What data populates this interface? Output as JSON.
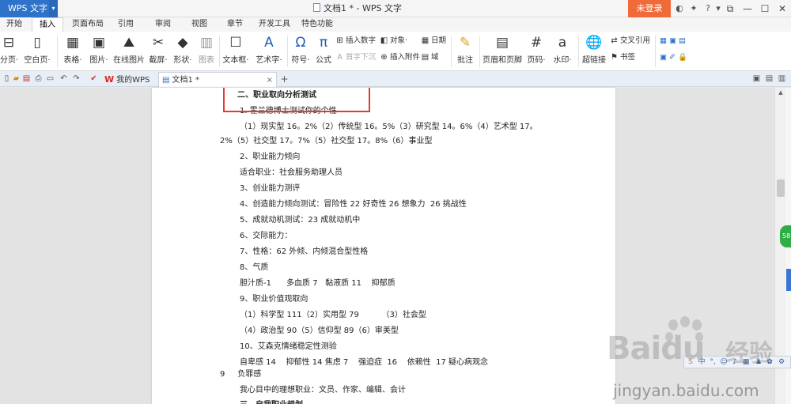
{
  "titlebar": {
    "app_name": "WPS 文字",
    "doc_title": "文档1 * - WPS 文字",
    "login_label": "未登录",
    "help_label": "?"
  },
  "ribbon_tabs": [
    "开始",
    "插入",
    "页面布局",
    "引用",
    "审阅",
    "视图",
    "章节",
    "开发工具",
    "特色功能"
  ],
  "active_tab_index": 1,
  "ribbon": {
    "big": [
      {
        "label": "分页·",
        "icon": "page-break-icon",
        "glyph": "⊟"
      },
      {
        "label": "空白页·",
        "icon": "blank-page-icon",
        "glyph": "▯"
      },
      {
        "label": "表格·",
        "icon": "table-icon",
        "glyph": "▦"
      },
      {
        "label": "图片·",
        "icon": "picture-icon",
        "glyph": "▣"
      },
      {
        "label": "在线图片",
        "icon": "online-picture-icon",
        "glyph": "⛰"
      },
      {
        "label": "截屏·",
        "icon": "screenshot-icon",
        "glyph": "✂"
      },
      {
        "label": "形状·",
        "icon": "shapes-icon",
        "glyph": "◆"
      },
      {
        "label": "图表",
        "icon": "chart-icon",
        "glyph": "▥"
      },
      {
        "label": "文本框·",
        "icon": "textbox-icon",
        "glyph": "☐"
      },
      {
        "label": "艺术字·",
        "icon": "wordart-icon",
        "glyph": "A"
      },
      {
        "label": "符号·",
        "icon": "symbol-icon",
        "glyph": "Ω"
      },
      {
        "label": "公式",
        "icon": "formula-icon",
        "glyph": "π"
      },
      {
        "label": "批注",
        "icon": "comment-icon",
        "glyph": "✎"
      },
      {
        "label": "页眉和页脚",
        "icon": "header-footer-icon",
        "glyph": "▤"
      },
      {
        "label": "页码·",
        "icon": "page-number-icon",
        "glyph": "#"
      },
      {
        "label": "水印·",
        "icon": "watermark-icon",
        "glyph": "a"
      },
      {
        "label": "超链接",
        "icon": "hyperlink-icon",
        "glyph": "🌐"
      }
    ],
    "small": [
      {
        "label": "插入数字",
        "icon": "insert-number-icon",
        "glyph": "⊞",
        "disabled": false
      },
      {
        "label": "对象·",
        "icon": "object-icon",
        "glyph": "◧",
        "disabled": false
      },
      {
        "label": "日期",
        "icon": "date-icon",
        "glyph": "▦",
        "disabled": false
      },
      {
        "label": "首字下沉",
        "icon": "drop-cap-icon",
        "glyph": "A",
        "disabled": true
      },
      {
        "label": "插入附件",
        "icon": "attachment-icon",
        "glyph": "⊕",
        "disabled": false
      },
      {
        "label": "域",
        "icon": "field-icon",
        "glyph": "▤",
        "disabled": false
      },
      {
        "label": "交叉引用",
        "icon": "cross-reference-icon",
        "glyph": "⇄",
        "disabled": false
      },
      {
        "label": "书签",
        "icon": "bookmark-icon",
        "glyph": "⚑",
        "disabled": false
      }
    ]
  },
  "quickbar": {
    "my_wps": "我的WPS",
    "doc_tab": "文档1 *",
    "close": "×",
    "add": "+"
  },
  "document": {
    "lines": [
      {
        "text": "二、职业取向分析测试",
        "bold": true
      },
      {
        "text": "1. 霍兰德博士测试你的个性",
        "bold": false
      },
      {
        "text": "（1）现实型 16。2%（2）传统型 16。5%（3）研究型 14。6%（4）艺术型 17。",
        "bold": false
      },
      {
        "text": "2%（5）社交型 17。7%（5）社交型 17。8%（6）事业型",
        "bold": false
      },
      {
        "text": "2、职业能力倾向",
        "bold": false
      },
      {
        "text": "适合职业：社会服务助理人员",
        "bold": false
      },
      {
        "text": "3、创业能力测评",
        "bold": false
      },
      {
        "text": "4、创造能力倾向测试：冒险性 22 好奇性 26 想象力  26 挑战性",
        "bold": false
      },
      {
        "text": "5、成就动机测试：23 成就动机中",
        "bold": false
      },
      {
        "text": "6、交际能力：",
        "bold": false
      },
      {
        "text": "7、性格：62 外倾、内倾混合型性格",
        "bold": false
      },
      {
        "text": "8、气质",
        "bold": false
      },
      {
        "text": "胆汁质-1      多血质 7   黏液质 11    抑郁质",
        "bold": false
      },
      {
        "text": "9、职业价值观取向",
        "bold": false
      },
      {
        "text": "（1）科学型 111（2）实用型 79         （3）社会型",
        "bold": false
      },
      {
        "text": "（4）政治型 90（5）信仰型 89（6）审美型",
        "bold": false
      },
      {
        "text": "10、艾森克情绪稳定性测验",
        "bold": false
      },
      {
        "text": "自卑感 14    抑郁性 14 焦虑 7    强迫症  16    依赖性  17 疑心病观念",
        "bold": false
      },
      {
        "text": "9     负罪感",
        "bold": false
      },
      {
        "text": "我心目中的理想职业：文员、作家、编辑、会计",
        "bold": false
      },
      {
        "text": "三、自我职业规划",
        "bold": true
      }
    ]
  },
  "side_badge": "58",
  "watermark": {
    "brand": "Baidu",
    "brand_cn": "经验",
    "url": "jingyan.baidu.com"
  },
  "colors": {
    "app_blue": "#2e73c9",
    "login_orange": "#f06a3a",
    "highlight_red": "#e23b33",
    "side_green": "#2fae46"
  }
}
